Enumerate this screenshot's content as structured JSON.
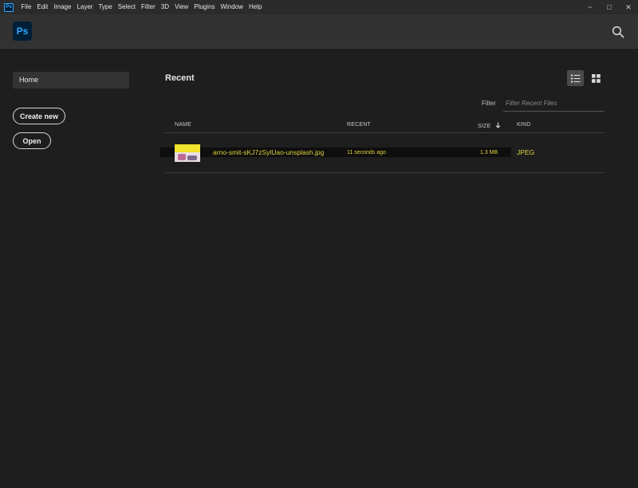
{
  "menubar": {
    "app_icon": "Ps",
    "items": [
      "File",
      "Edit",
      "Image",
      "Layer",
      "Type",
      "Select",
      "Filter",
      "3D",
      "View",
      "Plugins",
      "Window",
      "Help"
    ],
    "controls": [
      "−",
      "□",
      "✕"
    ]
  },
  "header": {
    "logo": "Ps",
    "search_icon": "search-icon"
  },
  "sidebar": {
    "home_label": "Home",
    "create_label": "Create new",
    "open_label": "Open"
  },
  "main": {
    "title": "Recent",
    "filter_label": "Filter",
    "filter_placeholder": "Filter Recent Files",
    "columns": {
      "name": "NAME",
      "recent": "RECENT",
      "size": "SIZE",
      "kind": "KIND"
    },
    "files": [
      {
        "name": "arno-smit-sKJ7zSylUao-unsplash.jpg",
        "recent": "11 seconds ago",
        "size": "1.3 MB",
        "kind": "JPEG"
      }
    ]
  },
  "colors": {
    "background": "#1e1e1e",
    "header": "#323232",
    "accent_text": "#e1d33e",
    "ps_blue": "#31a8ff"
  }
}
